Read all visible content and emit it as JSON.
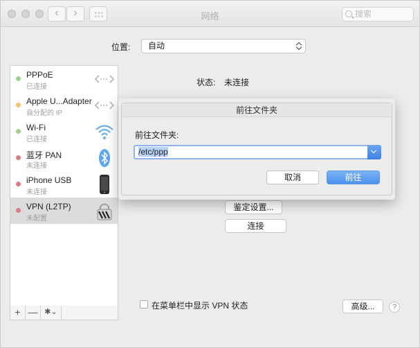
{
  "window": {
    "title": "网络",
    "search_placeholder": "搜索"
  },
  "location": {
    "label": "位置:",
    "value": "自动"
  },
  "services": [
    {
      "name": "PPPoE",
      "status": "已连接",
      "dot_color": "#9fcf8f",
      "icon": "ethernet-arrows-icon"
    },
    {
      "name": "Apple U...Adapter",
      "status": "自分配的 IP",
      "dot_color": "#f2c371",
      "icon": "ethernet-arrows-icon"
    },
    {
      "name": "Wi-Fi",
      "status": "已连接",
      "dot_color": "#9fcf8f",
      "icon": "wifi-icon"
    },
    {
      "name": "蓝牙 PAN",
      "status": "未连接",
      "dot_color": "#d97c84",
      "icon": "bluetooth-icon"
    },
    {
      "name": "iPhone USB",
      "status": "未连接",
      "dot_color": "#d97c84",
      "icon": "iphone-icon"
    },
    {
      "name": "VPN (L2TP)",
      "status": "未配置",
      "dot_color": "#d97c84",
      "icon": "vpn-lock-icon"
    }
  ],
  "sidebar_toolbar": {
    "add": "+",
    "remove": "—",
    "gear": "✱",
    "gear_chevron": "⌄"
  },
  "detail": {
    "status_label": "状态:",
    "status_value": "未连接",
    "auth_button": "鉴定设置...",
    "connect_button": "连接",
    "show_vpn_label": "在菜单栏中显示 VPN 状态",
    "advanced_button": "高级...",
    "help": "?"
  },
  "dialog": {
    "title": "前往文件夹",
    "label": "前往文件夹:",
    "input_value": "/etc/ppp",
    "cancel": "取消",
    "go": "前往"
  },
  "colors": {
    "accent": "#4d90ec",
    "selection": "#b8d2f7"
  }
}
